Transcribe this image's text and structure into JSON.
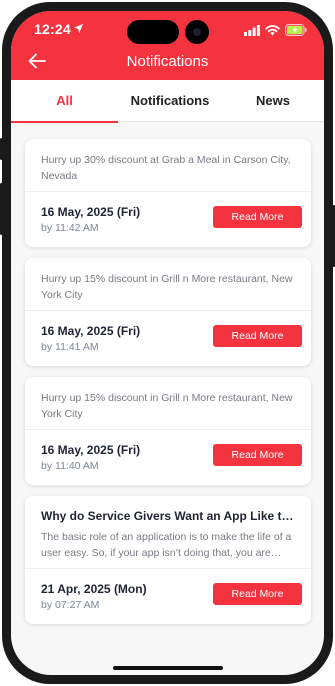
{
  "status": {
    "time": "12:24"
  },
  "header": {
    "title": "Notifications"
  },
  "tabs": [
    {
      "label": "All",
      "active": true
    },
    {
      "label": "Notifications",
      "active": false
    },
    {
      "label": "News",
      "active": false
    }
  ],
  "cards": [
    {
      "heading": "",
      "text": "Hurry up 30% discount at Grab a Meal in Carson City, Nevada",
      "date": "16 May, 2025 (Fri)",
      "by": "by 11:42 AM",
      "button": "Read More"
    },
    {
      "heading": "",
      "text": "Hurry up 15% discount in Grill n More restaurant, New York City",
      "date": "16 May, 2025 (Fri)",
      "by": "by 11:41 AM",
      "button": "Read More"
    },
    {
      "heading": "",
      "text": "Hurry up 15% discount in Grill n More restaurant, New York City",
      "date": "16 May, 2025 (Fri)",
      "by": "by 11:40 AM",
      "button": "Read More"
    },
    {
      "heading": "Why do Service Givers Want an App Like th...",
      "text": "The basic role of an application is to make the life of a user easy. So, if your app isn’t doing that, you are…",
      "date": "21 Apr, 2025 (Mon)",
      "by": "by 07:27 AM",
      "button": "Read More"
    }
  ],
  "colors": {
    "accent": "#f5333f",
    "heading": "#1d2433",
    "muted": "#777b82"
  }
}
